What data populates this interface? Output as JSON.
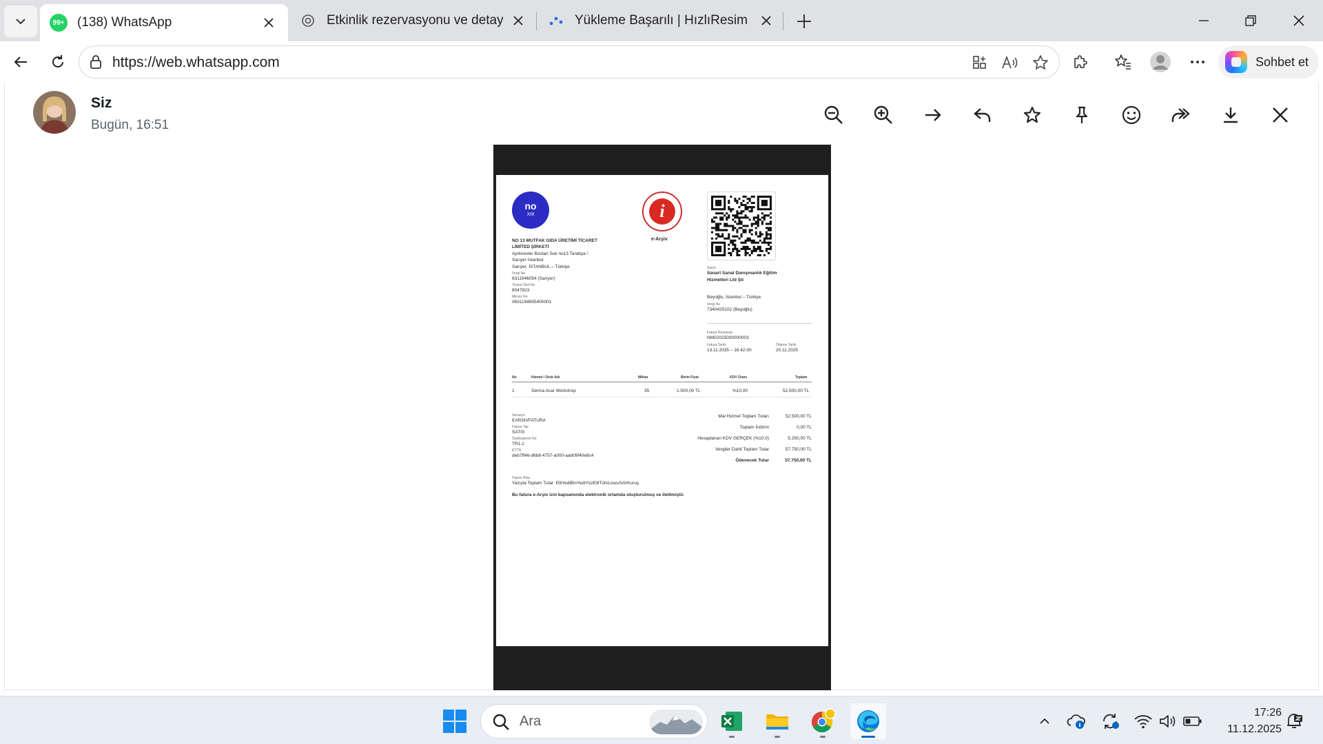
{
  "browser": {
    "tabs": [
      {
        "title": "(138) WhatsApp",
        "badge": "99+",
        "icon": "whatsapp-icon",
        "active": true
      },
      {
        "title": "Etkinlik rezervasyonu ve detaylar",
        "icon": "chatgpt-icon",
        "active": false
      },
      {
        "title": "Yükleme Başarılı | HızlıResim",
        "icon": "hizliresim-icon",
        "active": false
      }
    ],
    "url": "https://web.whatsapp.com",
    "copilot_label": "Sohbet et",
    "accent": "#0067c0"
  },
  "viewer": {
    "sender_name": "Siz",
    "timestamp": "Bugün, 16:51",
    "actions": [
      "zoom-out-icon",
      "zoom-in-icon",
      "arrow-right-icon",
      "reply-icon",
      "star-icon",
      "pin-icon",
      "emoji-icon",
      "forward-icon",
      "download-icon",
      "close-icon"
    ]
  },
  "invoice": {
    "logo_text": "no",
    "logo_sub": "XIII",
    "earsiv_label": "e-Arşiv",
    "seller": {
      "name_1": "NO 13 MUTFAK GIDA ÜRETİMİ TİCARET",
      "name_2": "LİMİTED ŞİRKETİ",
      "addr_1": "Aydınevler Bostan Sok no13 Tarabya /",
      "addr_2": "Sarıyer İstanbul",
      "addr_3": "Sarıyer, İSTANBUL – Türkiye",
      "tax_no_label": "Vergi No",
      "tax_no": "6311946054 (Sarıyer)",
      "trade_reg_label": "Ticaret Sicil No",
      "trade_reg": "8047823",
      "mersis_label": "Mersis No",
      "mersis": "0631194605400001"
    },
    "buyer": {
      "label": "Sayın",
      "name_1": "Sanart Sanat Danışmanlık Eğitim",
      "name_2": "Hizmetleri Ltd Şti",
      "addr": "Beyoğlu, İstanbul – Türkiye",
      "tax_no_label": "Vergi No",
      "tax_no": "7340425102 (Beyoğlu)"
    },
    "meta": {
      "invoice_no_label": "Fatura Numarası",
      "invoice_no": "NM02025000000003",
      "invoice_date_label": "Fatura Tarihi",
      "invoice_date": "13.11.2025 – 16:42:00",
      "due_date_label": "Ödeme Tarihi",
      "due_date": "20.11.2025"
    },
    "table": {
      "headers": [
        "No",
        "Hizmet / Ürün Adı",
        "Miktar",
        "Birim Fiyat",
        "KDV Oranı",
        "Toplam"
      ],
      "rows": [
        [
          "1",
          "Semra Acar Workshop",
          "35",
          "1.500,00 TL",
          "%10,00",
          "52.500,00 TL"
        ]
      ]
    },
    "details": {
      "scenario_label": "Senaryo",
      "scenario": "EARSIVFATURA",
      "type_label": "Fatura Tipi",
      "type": "SATIS",
      "custom_label": "Özelleştirme No",
      "custom": "TR1.2",
      "ettn_label": "ETTN",
      "ettn": "deb7ff46-d6b8-4757-a000-aab09f40e8c4"
    },
    "totals": [
      {
        "label": "Mal Hizmet Toplam Tutarı",
        "value": "52.500,00 TL"
      },
      {
        "label": "Toplam İndirim",
        "value": "0,00 TL"
      },
      {
        "label": "Hesaplanan KDV GERÇEK (%10.0)",
        "value": "5.250,00 TL"
      },
      {
        "label": "Vergiler Dahil Toplam Tutar",
        "value": "57.750,00 TL"
      },
      {
        "label": "Ödenecek Tutar",
        "value": "57.750,00 TL"
      }
    ],
    "note_label": "Fatura Notu",
    "note": "Yazıyla Toplam Tutar: ElliYediBinYediYüzElliTürkLirasıSıfırKuruş",
    "footer": "Bu fatura e-Arşiv izni kapsamında elektronik ortamda oluşturulmuş ve iletilmiştir."
  },
  "taskbar": {
    "search_placeholder": "Ara",
    "time": "17:26",
    "date": "11.12.2025"
  }
}
